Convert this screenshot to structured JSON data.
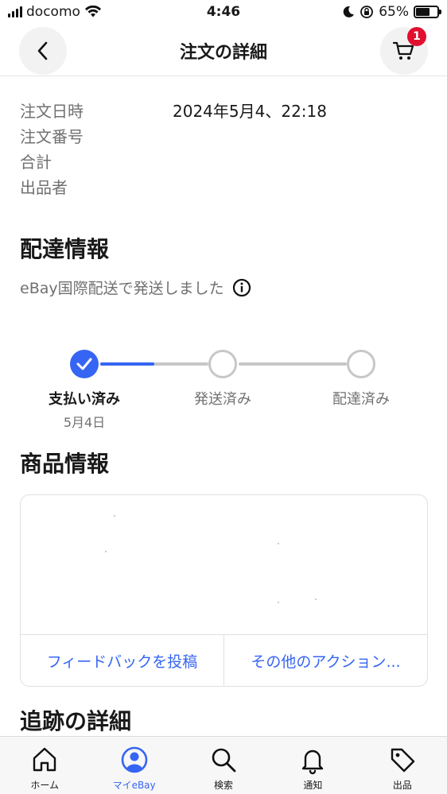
{
  "status_bar": {
    "carrier": "docomo",
    "time": "4:46",
    "battery": "65%",
    "battery_level": 0.65
  },
  "header": {
    "title": "注文の詳細",
    "cart_count": "1"
  },
  "order": {
    "date_label": "注文日時",
    "date_value": "2024年5月4、22:18",
    "number_label": "注文番号",
    "total_label": "合計",
    "seller_label": "出品者"
  },
  "shipping": {
    "title": "配達情報",
    "note": "eBay国際配送で発送しました",
    "steps": [
      {
        "label": "支払い済み",
        "date": "5月4日",
        "done": true
      },
      {
        "label": "発送済み",
        "date": "",
        "done": false
      },
      {
        "label": "配達済み",
        "date": "",
        "done": false
      }
    ],
    "progress": 0.5
  },
  "item": {
    "title": "商品情報",
    "feedback_button": "フィードバックを投稿",
    "more_actions_button": "その他のアクション..."
  },
  "tracking": {
    "title": "追跡の詳細"
  },
  "tabs": [
    {
      "label": "ホーム",
      "icon": "home-icon"
    },
    {
      "label": "マイeBay",
      "icon": "profile-icon"
    },
    {
      "label": "検索",
      "icon": "search-icon"
    },
    {
      "label": "通知",
      "icon": "bell-icon"
    },
    {
      "label": "出品",
      "icon": "tag-icon"
    }
  ],
  "colors": {
    "accent": "#3665f3",
    "badge": "#e0102e"
  }
}
